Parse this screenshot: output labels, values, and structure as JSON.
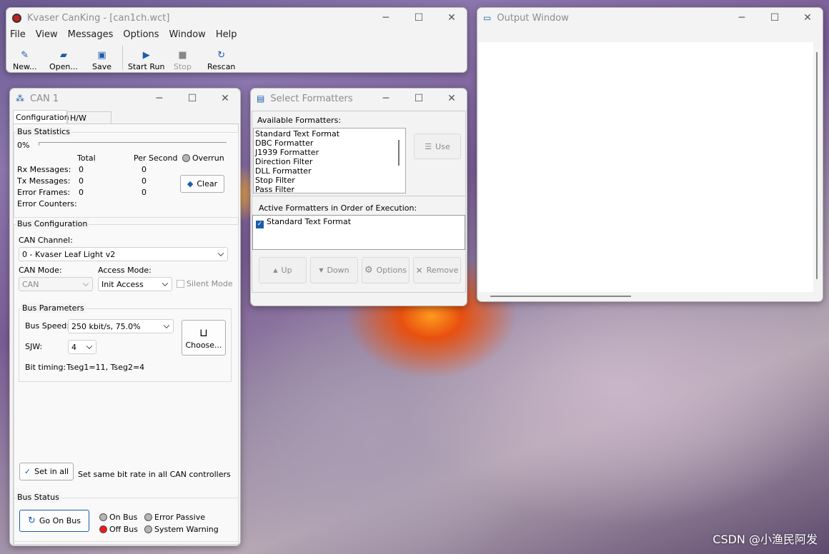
{
  "main": {
    "title": "Kvaser CanKing -  [can1ch.wct]",
    "menu": [
      "File",
      "View",
      "Messages",
      "Options",
      "Window",
      "Help"
    ],
    "toolbar": {
      "new": "New...",
      "open": "Open...",
      "save": "Save",
      "start": "Start Run",
      "stop": "Stop",
      "rescan": "Rescan"
    }
  },
  "can1": {
    "title": "CAN 1",
    "tabs": [
      "Configuration",
      "H/W Filters"
    ],
    "stats": {
      "group": "Bus Statistics",
      "load": "0%",
      "total_hdr": "Total",
      "persec_hdr": "Per Second",
      "overrun": "Overrun",
      "clear": "Clear",
      "rows": [
        {
          "label": "Rx Messages:",
          "total": "0",
          "persec": "0"
        },
        {
          "label": "Tx Messages:",
          "total": "0",
          "persec": "0"
        },
        {
          "label": "Error Frames:",
          "total": "0",
          "persec": "0"
        },
        {
          "label": "Error Counters:",
          "total": "",
          "persec": ""
        }
      ]
    },
    "config": {
      "group": "Bus Configuration",
      "channel_label": "CAN Channel:",
      "channel_value": "0 - Kvaser Leaf Light v2",
      "mode_label": "CAN Mode:",
      "mode_value": "CAN",
      "access_label": "Access Mode:",
      "access_value": "Init Access",
      "silent": "Silent Mode"
    },
    "params": {
      "group": "Bus Parameters",
      "speed_label": "Bus Speed:",
      "speed_value": "250 kbit/s, 75.0%",
      "sjw_label": "SJW:",
      "sjw_value": "4",
      "choose": "Choose...",
      "bit_label": "Bit timing:",
      "bit_value": "Tseg1=11, Tseg2=4"
    },
    "setall": {
      "button": "Set in all",
      "desc": "Set same bit rate in all CAN controllers"
    },
    "status": {
      "group": "Bus Status",
      "go": "Go On Bus",
      "on": "On Bus",
      "off": "Off Bus",
      "err": "Error Passive",
      "sys": "System Warning"
    }
  },
  "formatters": {
    "title": "Select Formatters",
    "available_label": "Available Formatters:",
    "available": [
      "Standard Text Format",
      "DBC Formatter",
      "J1939 Formatter",
      "Direction Filter",
      "DLL Formatter",
      "Stop Filter",
      "Pass Filter"
    ],
    "use": "Use",
    "active_label": "Active Formatters in Order of Execution:",
    "active": [
      "Standard Text Format"
    ],
    "buttons": {
      "up": "Up",
      "down": "Down",
      "options": "Options",
      "remove": "Remove"
    }
  },
  "output": {
    "title": "Output Window"
  },
  "watermark": "CSDN @小渔民阿发"
}
